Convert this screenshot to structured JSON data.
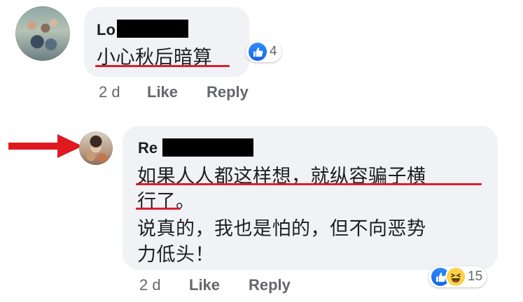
{
  "comments": [
    {
      "author": "Lo",
      "text_lines": [
        "小心秋后暗算"
      ],
      "reactions": {
        "count": "4",
        "types": [
          "like-icon"
        ]
      },
      "time": "2 d",
      "like_label": "Like",
      "reply_label": "Reply"
    },
    {
      "author": "Re",
      "text_lines": [
        "如果人人都这样想，就纵容骗子横",
        "行了。",
        "说真的，我也是怕的，但不向恶势",
        "力低头！"
      ],
      "reactions": {
        "count": "15",
        "types": [
          "like-icon",
          "haha-icon"
        ]
      },
      "time": "2 d",
      "like_label": "Like",
      "reply_label": "Reply"
    }
  ],
  "annotations": {
    "arrow_color": "#e0181f",
    "underline_color": "#d8202d"
  }
}
